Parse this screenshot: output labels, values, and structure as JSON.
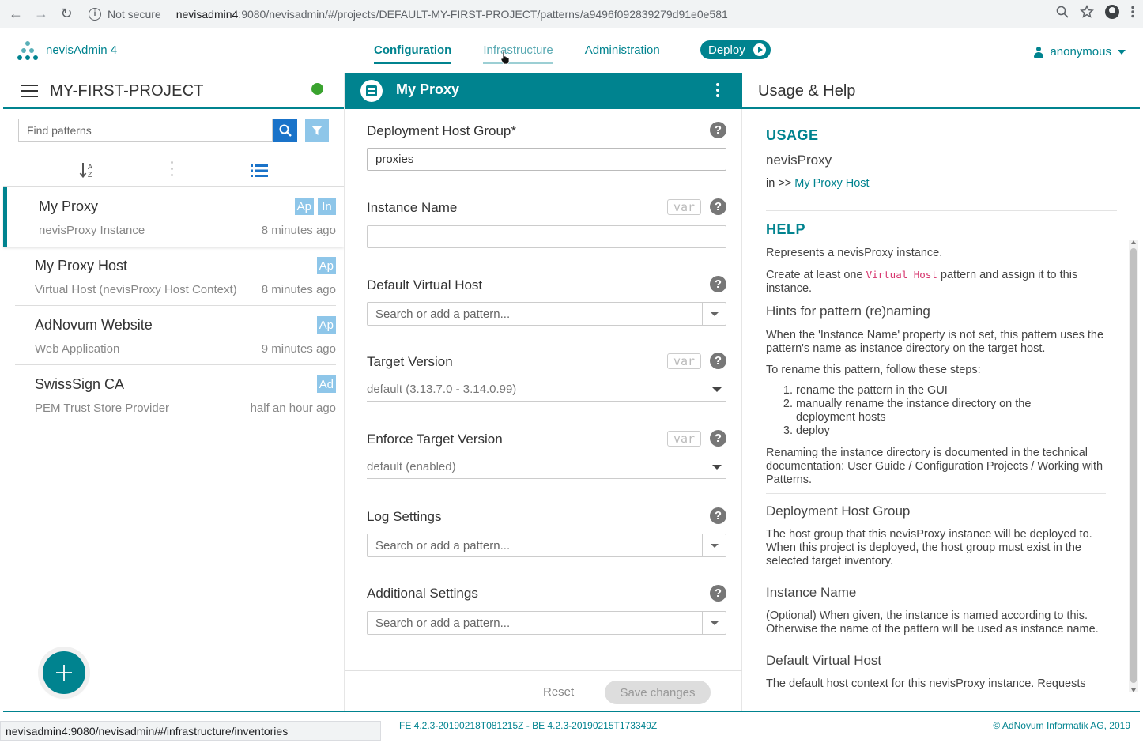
{
  "browser": {
    "security": "Not secure",
    "url_host": "nevisadmin4",
    "url_path": ":9080/nevisadmin/#/projects/DEFAULT-MY-FIRST-PROJECT/patterns/a9496f092839279d91e0e581",
    "status_url": "nevisadmin4:9080/nevisadmin/#/infrastructure/inventories"
  },
  "app": {
    "title": "nevisAdmin 4",
    "tabs": [
      "Configuration",
      "Infrastructure",
      "Administration"
    ],
    "deploy_label": "Deploy",
    "user": "anonymous"
  },
  "project": {
    "name": "MY-FIRST-PROJECT",
    "status_color": "#3aa32f",
    "search_placeholder": "Find patterns"
  },
  "patterns": [
    {
      "name": "My Proxy",
      "type": "nevisProxy Instance",
      "time": "8 minutes ago",
      "badges": [
        "Ap",
        "In"
      ],
      "selected": true
    },
    {
      "name": "My Proxy Host",
      "type": "Virtual Host (nevisProxy Host Context)",
      "time": "8 minutes ago",
      "badges": [
        "Ap"
      ]
    },
    {
      "name": "AdNovum Website",
      "type": "Web Application",
      "time": "9 minutes ago",
      "badges": [
        "Ap"
      ]
    },
    {
      "name": "SwissSign CA",
      "type": "PEM Trust Store Provider",
      "time": "half an hour ago",
      "badges": [
        "Ad"
      ]
    }
  ],
  "editor": {
    "title": "My Proxy",
    "var_label": "var",
    "fields": {
      "host_group": {
        "label": "Deployment Host Group*",
        "value": "proxies"
      },
      "instance_name": {
        "label": "Instance Name",
        "value": ""
      },
      "default_vhost": {
        "label": "Default Virtual Host",
        "placeholder": "Search or add a pattern..."
      },
      "target_version": {
        "label": "Target Version",
        "value": "default (3.13.7.0 - 3.14.0.99)"
      },
      "enforce_version": {
        "label": "Enforce Target Version",
        "value": "default (enabled)"
      },
      "log_settings": {
        "label": "Log Settings",
        "placeholder": "Search or add a pattern..."
      },
      "additional_settings": {
        "label": "Additional Settings",
        "placeholder": "Search or add a pattern..."
      }
    },
    "reset_label": "Reset",
    "save_label": "Save changes"
  },
  "help": {
    "panel_title": "Usage & Help",
    "usage_heading": "USAGE",
    "usage_name": "nevisProxy",
    "usage_in": "in >>",
    "usage_link": "My Proxy Host",
    "help_heading": "HELP",
    "p1": "Represents a nevisProxy instance.",
    "p2_a": "Create at least one",
    "p2_code": "Virtual Host",
    "p2_b": "pattern and assign it to this instance.",
    "hints_title": "Hints for pattern (re)naming",
    "hints_p1": "When the 'Instance Name' property is not set, this pattern uses the pattern's name as instance directory on the target host.",
    "hints_p2": "To rename this pattern, follow these steps:",
    "steps": [
      "rename the pattern in the GUI",
      "manually rename the instance directory on the deployment hosts",
      "deploy"
    ],
    "hints_p3": "Renaming the instance directory is documented in the technical documentation: User Guide / Configuration Projects / Working with Patterns.",
    "dhg_title": "Deployment Host Group",
    "dhg_text": "The host group that this nevisProxy instance will be deployed to. When this project is deployed, the host group must exist in the selected target inventory.",
    "in_title": "Instance Name",
    "in_text": "(Optional) When given, the instance is named according to this. Otherwise the name of the pattern will be used as instance name.",
    "dvh_title": "Default Virtual Host",
    "dvh_text": "The default host context for this nevisProxy instance. Requests"
  },
  "footer": {
    "version": "FE 4.2.3-20190218T081215Z - BE 4.2.3-20190215T173349Z",
    "copyright": "© AdNovum Informatik AG, 2019"
  }
}
